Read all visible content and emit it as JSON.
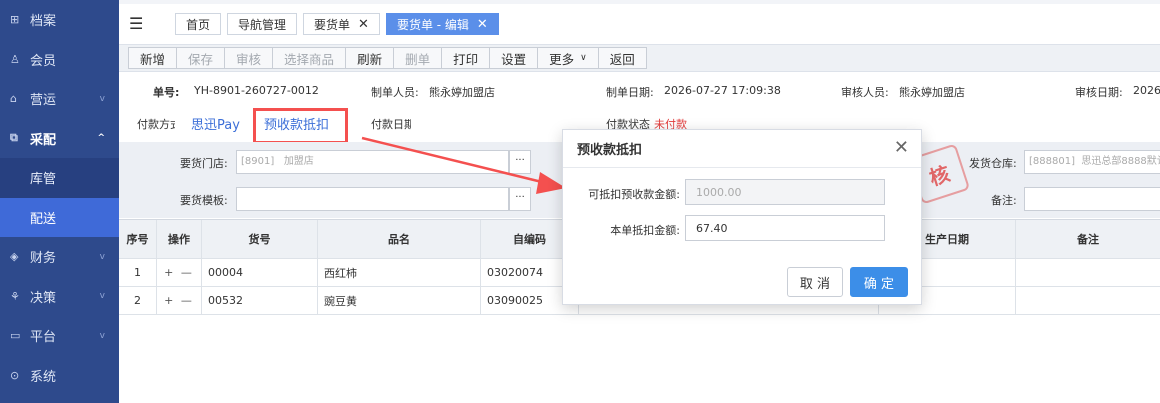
{
  "sidebar": {
    "items": [
      {
        "icon": "grid-icon",
        "glyph": "⊞",
        "label": "档案",
        "chevron": false
      },
      {
        "icon": "user-icon",
        "glyph": "♙",
        "label": "会员",
        "chevron": false
      },
      {
        "icon": "shop-icon",
        "glyph": "⌂",
        "label": "营运",
        "chevron": true
      },
      {
        "icon": "cube-icon",
        "glyph": "⧉",
        "label": "采配",
        "chevron": true
      },
      {
        "label": "库管"
      },
      {
        "label": "配送"
      },
      {
        "icon": "finance-icon",
        "glyph": "◈",
        "label": "财务",
        "chevron": true
      },
      {
        "icon": "decision-icon",
        "glyph": "⚘",
        "label": "决策",
        "chevron": true
      },
      {
        "icon": "platform-icon",
        "glyph": "▭",
        "label": "平台",
        "chevron": true
      },
      {
        "icon": "system-icon",
        "glyph": "⊙",
        "label": "系统",
        "chevron": false
      }
    ],
    "chevron_glyph": "v",
    "chevron_up_glyph": "^"
  },
  "tabs": {
    "menu_glyph": "☰",
    "items": [
      {
        "label": "首页",
        "closable": false
      },
      {
        "label": "导航管理",
        "closable": false
      },
      {
        "label": "要货单",
        "closable": true
      },
      {
        "label": "要货单 - 编辑",
        "closable": true
      }
    ],
    "close_glyph": "✕"
  },
  "toolbar": {
    "buttons": [
      {
        "label": "新增",
        "disabled": false
      },
      {
        "label": "保存",
        "disabled": true
      },
      {
        "label": "审核",
        "disabled": true
      },
      {
        "label": "选择商品",
        "disabled": true
      },
      {
        "label": "刷新",
        "disabled": false
      },
      {
        "label": "删单",
        "disabled": true
      },
      {
        "label": "打印",
        "disabled": false
      },
      {
        "label": "设置",
        "disabled": false
      },
      {
        "label": "更多",
        "disabled": false
      },
      {
        "label": "返回",
        "disabled": false
      }
    ],
    "more_caret": "∨"
  },
  "info": {
    "order_no_label": "单号:",
    "order_no": "YH-8901-260727-0012",
    "creator_label": "制单人员:",
    "creator": "熊永婷加盟店",
    "create_date_label": "制单日期:",
    "create_date": "2026-07-27 17:09:38",
    "reviewer_label": "审核人员:",
    "reviewer": "熊永婷加盟店",
    "review_date_label": "审核日期:",
    "review_date": "2026-"
  },
  "payment": {
    "method_label": "付款方式",
    "pay_option": "思迅Pay",
    "prepay_option": "预收款抵扣",
    "pay_date_label": "付款日期",
    "pay_status_label": "付款状态",
    "pay_status": "未付款"
  },
  "filters": {
    "store_label": "要货门店:",
    "store_value": "[8901]",
    "store_name": "加盟店",
    "template_label": "要货模板:",
    "warehouse_label": "发货仓库:",
    "warehouse_value": "[888801]",
    "warehouse_name": "思迅总部8888默认",
    "remark_label": "备注:",
    "dots": "···"
  },
  "stamp_text": "核",
  "table": {
    "headers": [
      "序号",
      "操作",
      "货号",
      "品名",
      "自编码",
      "生产日期",
      "备注"
    ],
    "ops_glyph": "+ —",
    "rows": [
      {
        "seq": "1",
        "code": "00004",
        "name": "西红柿",
        "self_code": "03020074"
      },
      {
        "seq": "2",
        "code": "00532",
        "name": "豌豆黄",
        "self_code": "03090025"
      }
    ]
  },
  "modal": {
    "title": "预收款抵扣",
    "close_glyph": "✕",
    "available_label": "可抵扣预收款金额:",
    "available_value": "1000.00",
    "deduct_label": "本单抵扣金额:",
    "deduct_value": "67.40",
    "cancel_label": "取 消",
    "ok_label": "确 定"
  },
  "colors": {
    "sidebar_bg": "#2e4a8c",
    "sidebar_selected": "#3f6ad8",
    "accent": "#3c8ee8",
    "annotation_red": "#f4504f",
    "unpaid_red": "#e23b3b"
  }
}
